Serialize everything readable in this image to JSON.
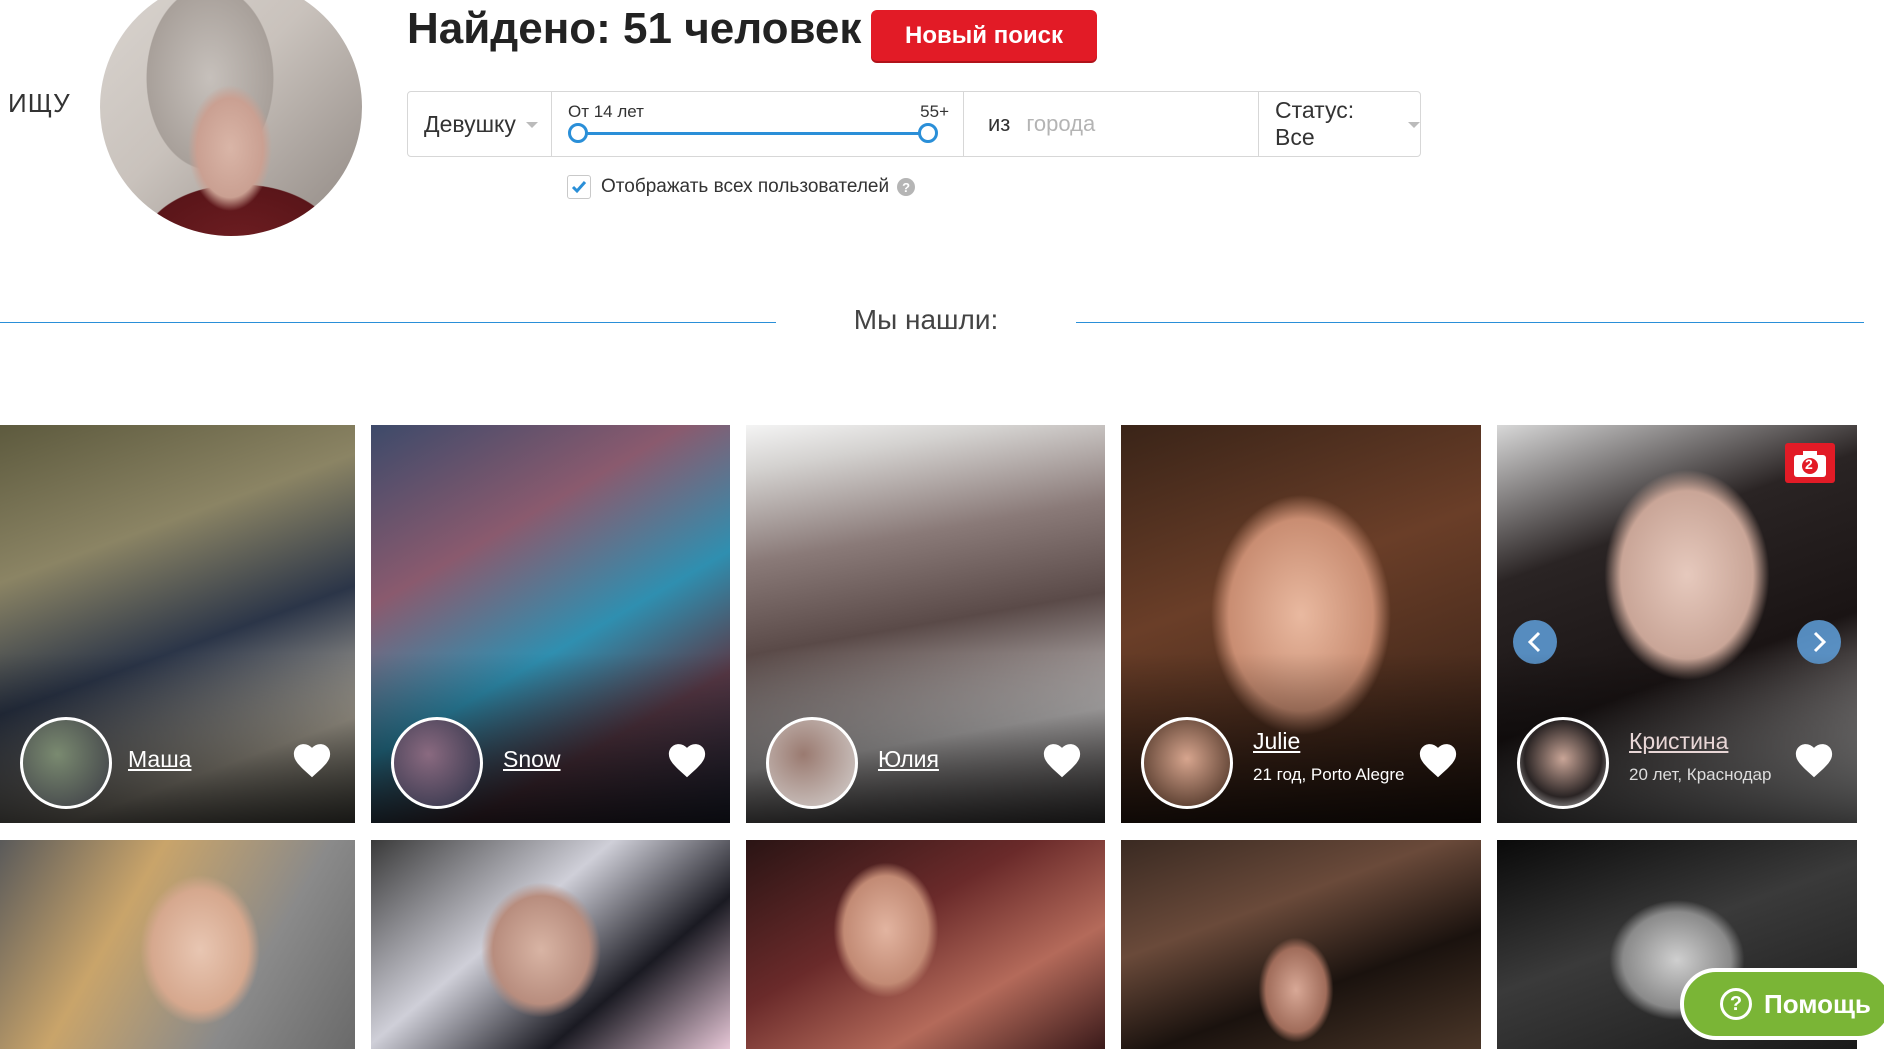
{
  "header": {
    "seeking_label": "ИЩУ",
    "found_title": "Найдено: 51 человек",
    "new_search_label": "Новый поиск"
  },
  "filters": {
    "gender": "Девушку",
    "age_from": "От 14 лет",
    "age_to": "55+",
    "city_prefix": "из",
    "city_placeholder": "города",
    "status": "Статус: Все",
    "show_all_label": "Отображать всех пользователей",
    "show_all_checked": true,
    "help_glyph": "?"
  },
  "section_title": "Мы нашли:",
  "cards": [
    {
      "name": "Маша",
      "sub": ""
    },
    {
      "name": "Snow",
      "sub": ""
    },
    {
      "name": "Юлия",
      "sub": ""
    },
    {
      "name": "Julie",
      "sub": "21 год, Porto Alegre"
    },
    {
      "name": "Кристина",
      "sub": "20 лет, Краснодар",
      "photo_count": "2"
    }
  ],
  "help_button": {
    "label": "Помощь",
    "glyph": "?"
  },
  "colors": {
    "accent_blue": "#2a8fd8",
    "brand_red": "#e21b26",
    "help_green": "#7ab536"
  }
}
